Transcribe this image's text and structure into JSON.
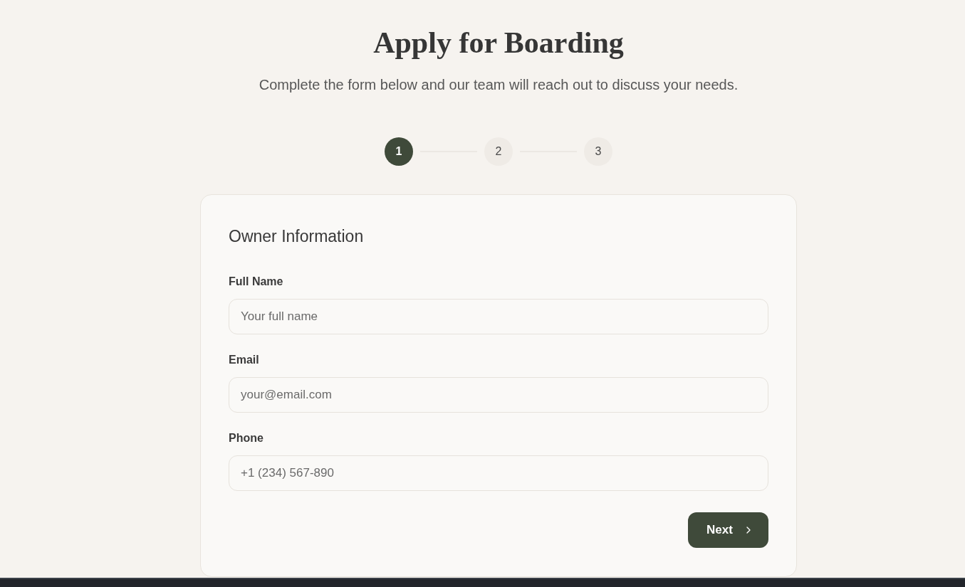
{
  "header": {
    "title": "Apply for Boarding",
    "subtitle": "Complete the form below and our team will reach out to discuss your needs."
  },
  "steps": [
    {
      "label": "1",
      "selected": true
    },
    {
      "label": "2",
      "selected": false
    },
    {
      "label": "3",
      "selected": false
    }
  ],
  "form": {
    "heading": "Owner Information",
    "fields": [
      {
        "label": "Full Name",
        "placeholder": "Your full name"
      },
      {
        "label": "Email",
        "placeholder": "your@email.com"
      },
      {
        "label": "Phone",
        "placeholder": "+1 (234) 567-890"
      }
    ],
    "next_button": {
      "label": "Next"
    }
  }
}
